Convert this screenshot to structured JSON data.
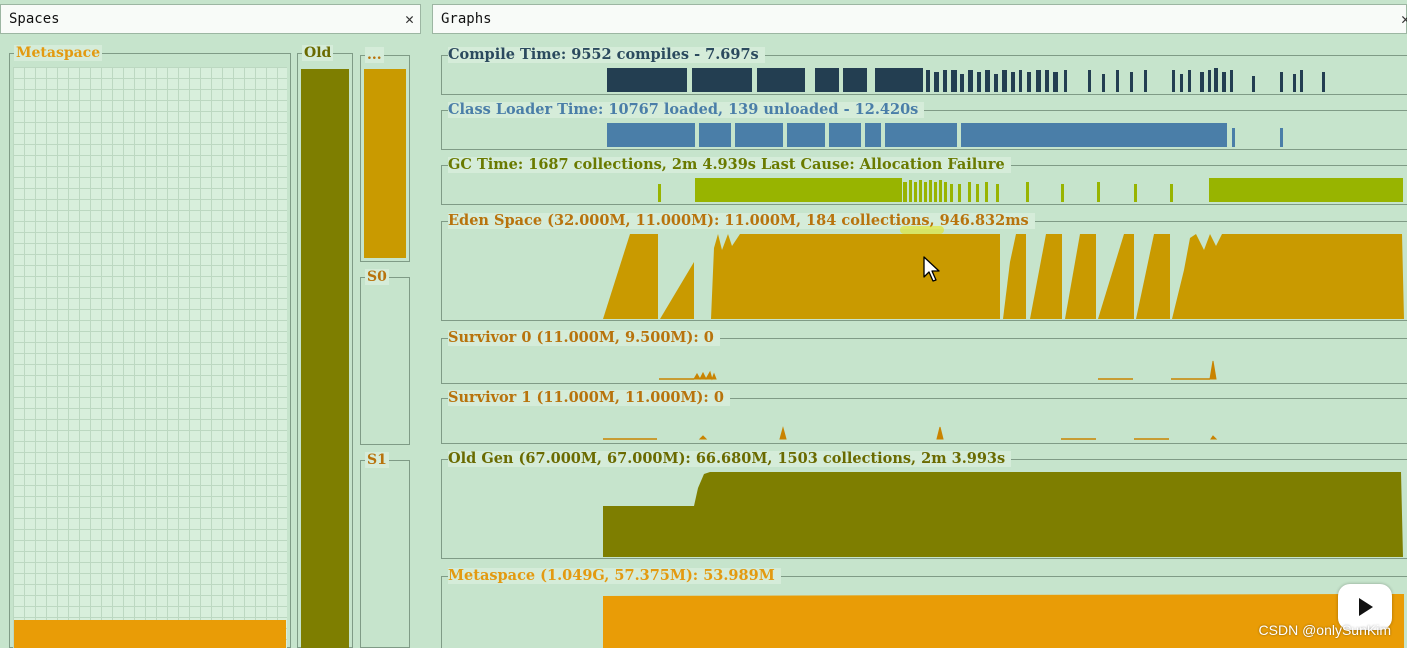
{
  "spaces": {
    "title": "Spaces",
    "close": "✕",
    "metaspace_label": "Metaspace",
    "metaspace_fill": 0.045,
    "old_label": "Old",
    "old_fill": 1.0,
    "eden_label": "...",
    "eden_fill": 0.98,
    "s0_label": "S0",
    "s0_fill": 0.0,
    "s1_label": "S1",
    "s1_fill": 0.0
  },
  "graphs": {
    "title": "Graphs",
    "close": "✕",
    "compile_title": "Compile Time: 9552 compiles - 7.697s",
    "classloader_title": "Class Loader Time: 10767 loaded, 139 unloaded - 12.420s",
    "gc_title": "GC Time: 1687 collections, 2m 4.939s  Last Cause: Allocation Failure",
    "eden_title": "Eden Space (32.000M, 11.000M): 11.000M, 184 collections, 946.832ms",
    "s0_title": "Survivor 0 (11.000M, 9.500M): 0",
    "s1_title": "Survivor 1 (11.000M, 11.000M): 0",
    "oldgen_title": "Old Gen (67.000M, 67.000M): 66.680M, 1503 collections, 2m 3.993s",
    "metaspace_title": "Metaspace (1.049G, 57.375M): 53.989M"
  },
  "colors": {
    "compile": "#233e51",
    "classloader": "#4a7ea8",
    "gc": "#98b400",
    "eden": "#c99a00",
    "survivor": "#c98300",
    "oldgen": "#7e7e00",
    "metaspace": "#e99c06",
    "title_blue": "#2b4a5e",
    "title_orange": "#b8730d",
    "title_olive": "#6a6a00",
    "title_meta": "#e39a10"
  },
  "watermark": "CSDN @onlySunKim"
}
